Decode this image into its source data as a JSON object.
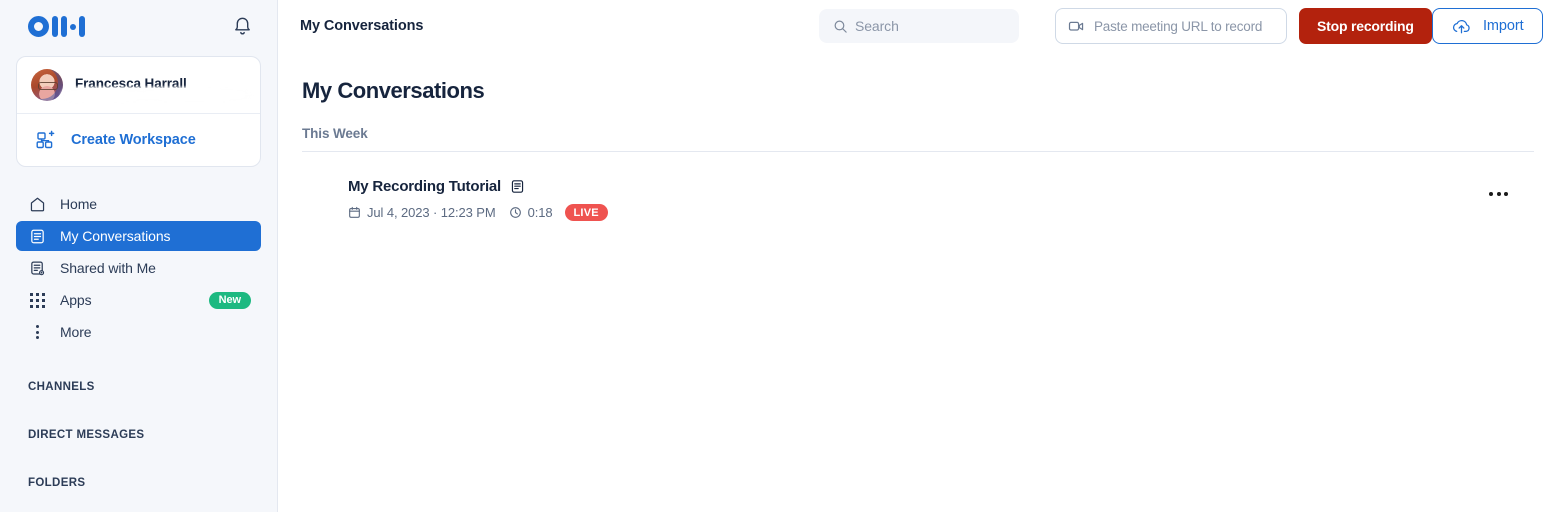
{
  "brand": {
    "logo_name": "otter-logo",
    "primary": "#1f6fd4",
    "danger": "#b3220d",
    "live": "#ef5350",
    "new_badge": "#1db981"
  },
  "sidebar": {
    "notification_icon": "bell-icon",
    "profile": {
      "name": "Francesca Harrall",
      "subtitle": "",
      "avatar_icon": "avatar"
    },
    "create_workspace": {
      "label": "Create Workspace",
      "icon": "workspace-add-icon"
    },
    "items": [
      {
        "label": "Home",
        "icon": "home-icon",
        "active": false,
        "badge": ""
      },
      {
        "label": "My Conversations",
        "icon": "document-icon",
        "active": true,
        "badge": ""
      },
      {
        "label": "Shared with Me",
        "icon": "shared-document-icon",
        "active": false,
        "badge": ""
      },
      {
        "label": "Apps",
        "icon": "grid-icon",
        "active": false,
        "badge": "New"
      },
      {
        "label": "More",
        "icon": "more-vertical-icon",
        "active": false,
        "badge": ""
      }
    ],
    "sections": [
      {
        "label": "CHANNELS"
      },
      {
        "label": "DIRECT MESSAGES"
      },
      {
        "label": "FOLDERS"
      }
    ]
  },
  "topbar": {
    "title": "My Conversations",
    "search": {
      "placeholder": "Search",
      "value": "",
      "icon": "search-icon"
    },
    "meeting_url": {
      "placeholder": "Paste meeting URL to record",
      "value": "",
      "icon": "video-camera-icon"
    },
    "stop_recording_label": "Stop recording",
    "import_label": "Import",
    "import_icon": "cloud-upload-icon"
  },
  "main": {
    "page_title": "My Conversations",
    "group_label": "This Week",
    "conversations": [
      {
        "title": "My Recording Tutorial",
        "title_icon": "transcript-icon",
        "date": "Jul 4, 2023 · 12:23 PM",
        "date_icon": "calendar-icon",
        "duration": "0:18",
        "duration_icon": "clock-icon",
        "status_badge": "LIVE",
        "menu_icon": "more-horizontal-icon"
      }
    ]
  }
}
